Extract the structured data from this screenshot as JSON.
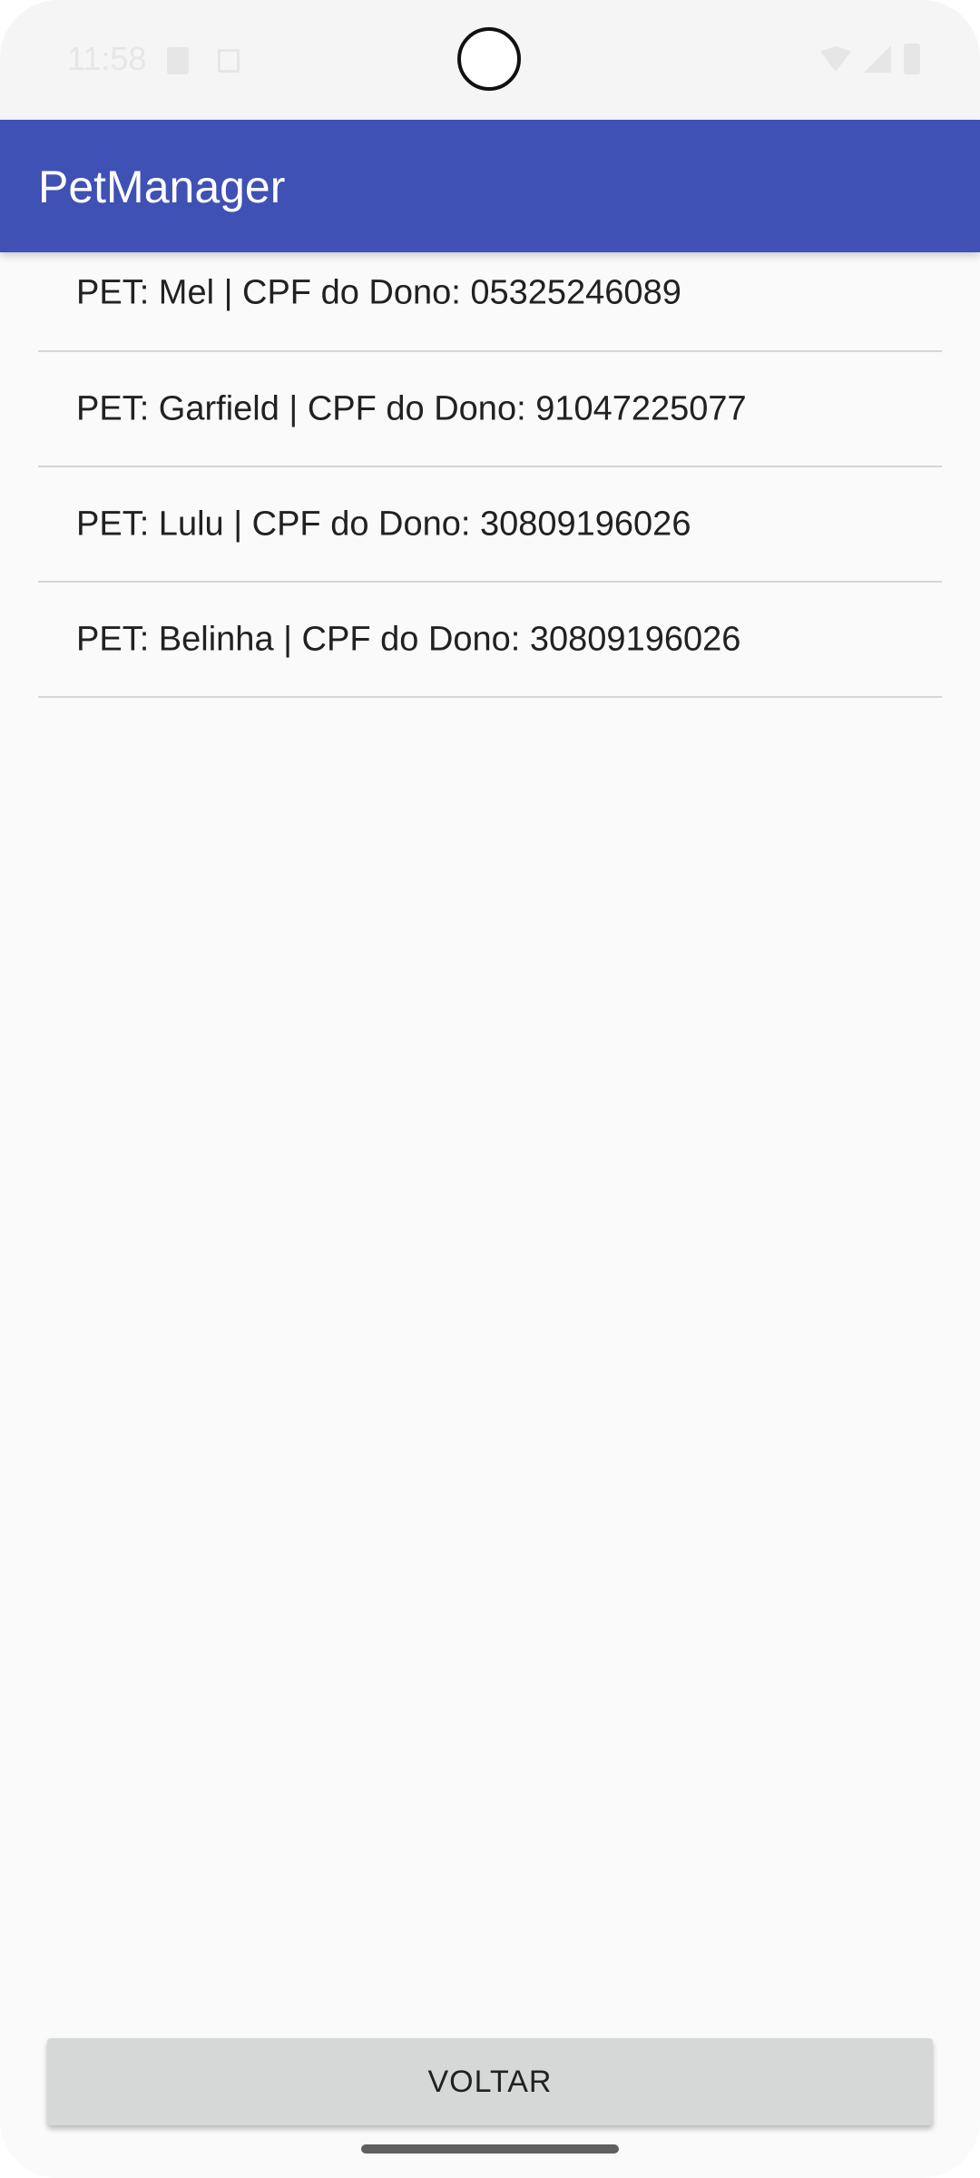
{
  "status_bar": {
    "time": "11:58"
  },
  "app_bar": {
    "title": "PetManager",
    "color": "#3f51b5"
  },
  "pet_list": {
    "items": [
      {
        "label": "PET: Mel | CPF do Dono: 05325246089"
      },
      {
        "label": "PET: Garfield | CPF do Dono: 91047225077"
      },
      {
        "label": "PET: Lulu | CPF do Dono: 30809196026"
      },
      {
        "label": "PET: Belinha | CPF do Dono: 30809196026"
      }
    ]
  },
  "footer": {
    "back_label": "VOLTAR"
  },
  "icons": {
    "status": [
      "sd-card-icon",
      "notification-a-icon",
      "wifi-icon",
      "signal-icon",
      "battery-icon"
    ]
  }
}
